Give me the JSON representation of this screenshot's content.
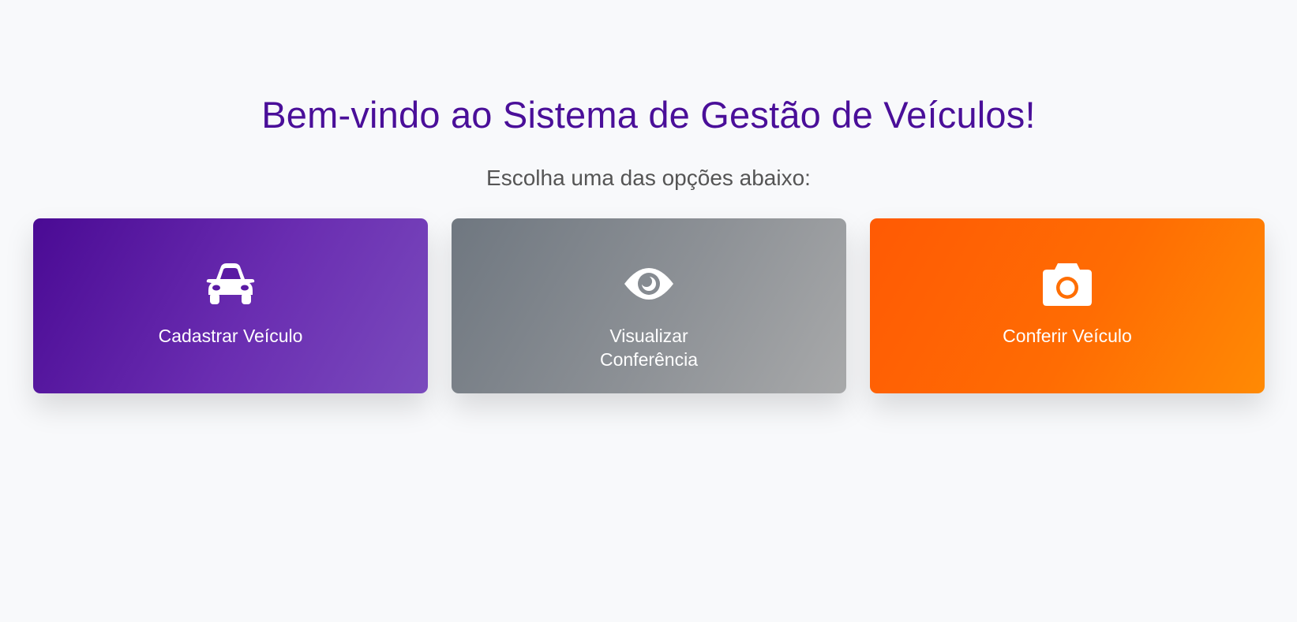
{
  "header": {
    "title": "Bem-vindo ao Sistema de Gestão de Veículos!",
    "subtitle": "Escolha uma das opções abaixo:"
  },
  "cards": [
    {
      "icon": "car-icon",
      "label": "Cadastrar Veículo",
      "color_start": "#4a0a94",
      "color_end": "#7a4bbd"
    },
    {
      "icon": "eye-icon",
      "label_line1": "Visualizar",
      "label_line2": "Conferência",
      "color_start": "#6f7780",
      "color_end": "#a8a9aa"
    },
    {
      "icon": "camera-icon",
      "label": "Conferir Veículo",
      "color_start": "#ff5a04",
      "color_end": "#ff8a04"
    }
  ],
  "colors": {
    "title": "#4a0f99",
    "subtitle": "#555555",
    "background": "#f8f9fb"
  }
}
